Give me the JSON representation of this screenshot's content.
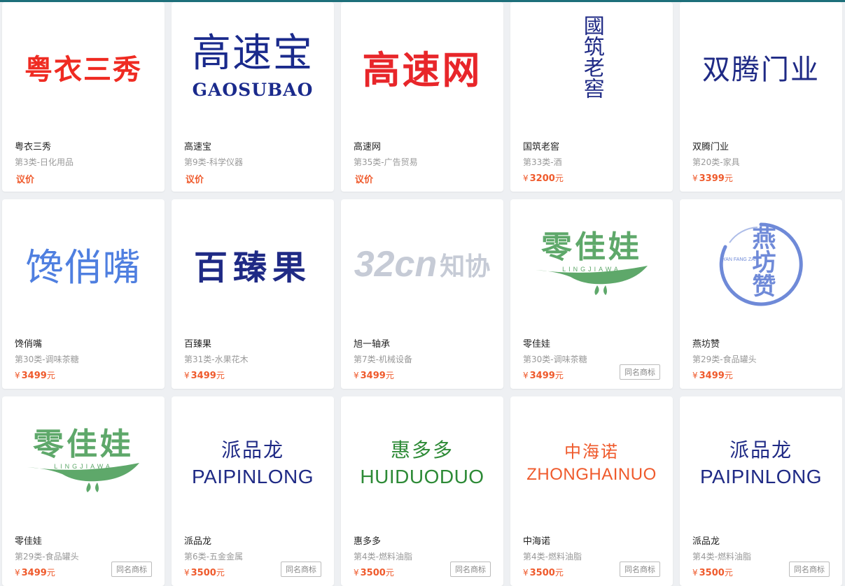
{
  "cards": [
    {
      "logo": [
        "粤衣三秀"
      ],
      "name": "粤衣三秀",
      "category": "第3类-日化用品",
      "price": "议价",
      "currency": "",
      "unit": "",
      "same_name": false
    },
    {
      "logo": [
        "高速宝",
        "GAOSUBAO"
      ],
      "name": "高速宝",
      "category": "第9类-科学仪器",
      "price": "议价",
      "currency": "",
      "unit": "",
      "same_name": false
    },
    {
      "logo": [
        "高速网"
      ],
      "name": "高速网",
      "category": "第35类-广告贸易",
      "price": "议价",
      "currency": "",
      "unit": "",
      "same_name": false
    },
    {
      "logo": [
        "國筑老窖"
      ],
      "name": "国筑老窖",
      "category": "第33类-酒",
      "price": "3200",
      "currency": "¥",
      "unit": "元",
      "same_name": false
    },
    {
      "logo": [
        "双腾门业"
      ],
      "name": "双腾门业",
      "category": "第20类-家具",
      "price": "3399",
      "currency": "¥",
      "unit": "元",
      "same_name": false
    },
    {
      "logo": [
        "馋俏嘴"
      ],
      "name": "馋俏嘴",
      "category": "第30类-调味茶糖",
      "price": "3499",
      "currency": "¥",
      "unit": "元",
      "same_name": false
    },
    {
      "logo": [
        "百臻果"
      ],
      "name": "百臻果",
      "category": "第31类-水果花木",
      "price": "3499",
      "currency": "¥",
      "unit": "元",
      "same_name": false
    },
    {
      "logo": [
        "32cn",
        "知协"
      ],
      "name": "旭一轴承",
      "category": "第7类-机械设备",
      "price": "3499",
      "currency": "¥",
      "unit": "元",
      "same_name": false
    },
    {
      "logo": [
        "零佳娃",
        "LINGJIAWA"
      ],
      "name": "零佳娃",
      "category": "第30类-调味茶糖",
      "price": "3499",
      "currency": "¥",
      "unit": "元",
      "same_name": true
    },
    {
      "logo": [
        "燕坊赞",
        "YAN FANG ZAN"
      ],
      "name": "燕坊赞",
      "category": "第29类-食品罐头",
      "price": "3499",
      "currency": "¥",
      "unit": "元",
      "same_name": false
    },
    {
      "logo": [
        "零佳娃",
        "LINGJIAWA"
      ],
      "name": "零佳娃",
      "category": "第29类-食品罐头",
      "price": "3499",
      "currency": "¥",
      "unit": "元",
      "same_name": true
    },
    {
      "logo": [
        "派品龙",
        "PAIPINLONG"
      ],
      "name": "派品龙",
      "category": "第6类-五金金属",
      "price": "3500",
      "currency": "¥",
      "unit": "元",
      "same_name": true
    },
    {
      "logo": [
        "惠多多",
        "HUIDUODUO"
      ],
      "name": "惠多多",
      "category": "第4类-燃料油脂",
      "price": "3500",
      "currency": "¥",
      "unit": "元",
      "same_name": true
    },
    {
      "logo": [
        "中海诺",
        "ZHONGHAINUO"
      ],
      "name": "中海诺",
      "category": "第4类-燃料油脂",
      "price": "3500",
      "currency": "¥",
      "unit": "元",
      "same_name": true
    },
    {
      "logo": [
        "派品龙",
        "PAIPINLONG"
      ],
      "name": "派品龙",
      "category": "第4类-燃料油脂",
      "price": "3500",
      "currency": "¥",
      "unit": "元",
      "same_name": true
    }
  ],
  "same_name_label": "同名商标"
}
